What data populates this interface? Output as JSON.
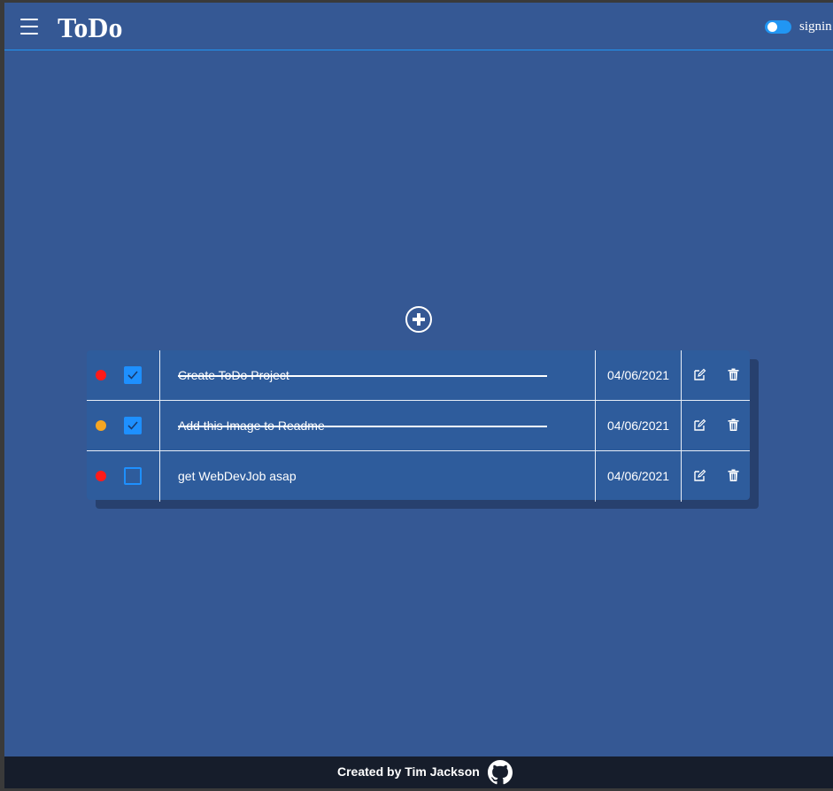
{
  "header": {
    "title": "ToDo",
    "signin_label": "signin",
    "menu_icon": "hamburger-menu-icon",
    "toggle_state": "on"
  },
  "main": {
    "add_icon": "plus-circle-icon",
    "todos": [
      {
        "text": "Create ToDo Project",
        "date": "04/06/2021",
        "completed": true,
        "priority_color": "#ff1a1a"
      },
      {
        "text": "Add this Image to Readme",
        "date": "04/06/2021",
        "completed": true,
        "priority_color": "#f5a623"
      },
      {
        "text": "get WebDevJob asap",
        "date": "04/06/2021",
        "completed": false,
        "priority_color": "#ff1a1a"
      }
    ],
    "row_icons": {
      "edit": "edit-icon",
      "delete": "trash-icon"
    }
  },
  "footer": {
    "credit": "Created by Tim Jackson",
    "icon": "github-icon"
  },
  "colors": {
    "background": "#355894",
    "accent": "#2196f3",
    "table": "#2e5c9c",
    "footer": "#161d2b"
  }
}
